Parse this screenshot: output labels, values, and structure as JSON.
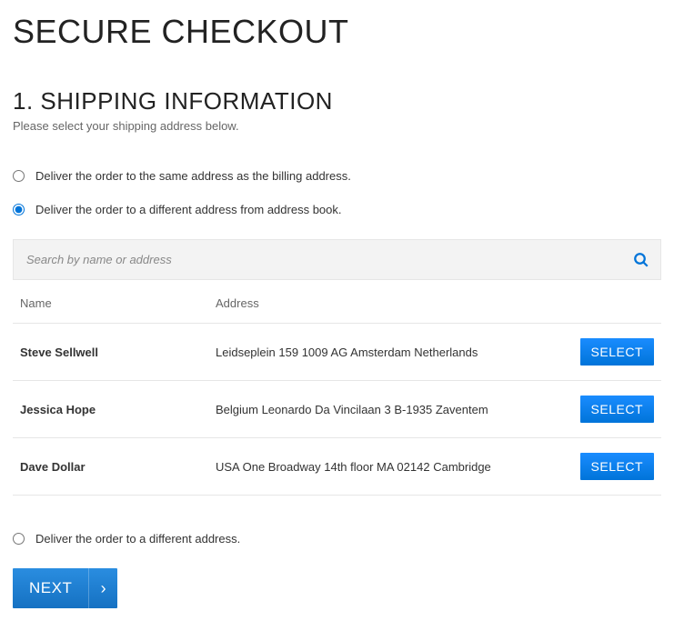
{
  "page_title": "SECURE CHECKOUT",
  "section": {
    "title": "1. SHIPPING INFORMATION",
    "subtitle": "Please select your shipping address below."
  },
  "delivery_options": {
    "same_as_billing": "Deliver the order to the same address as the billing address.",
    "from_address_book": "Deliver the order to a different address from address book.",
    "different_address": "Deliver the order to a different address."
  },
  "search": {
    "placeholder": "Search by name or address"
  },
  "table": {
    "headers": {
      "name": "Name",
      "address": "Address"
    },
    "rows": [
      {
        "name": "Steve Sellwell",
        "address": "Leidseplein 159 1009 AG Amsterdam Netherlands"
      },
      {
        "name": "Jessica Hope",
        "address": "Belgium Leonardo Da Vincilaan 3 B-1935 Zaventem"
      },
      {
        "name": "Dave Dollar",
        "address": "USA One Broadway 14th floor MA 02142 Cambridge"
      }
    ],
    "select_label": "SELECT"
  },
  "next_label": "NEXT"
}
